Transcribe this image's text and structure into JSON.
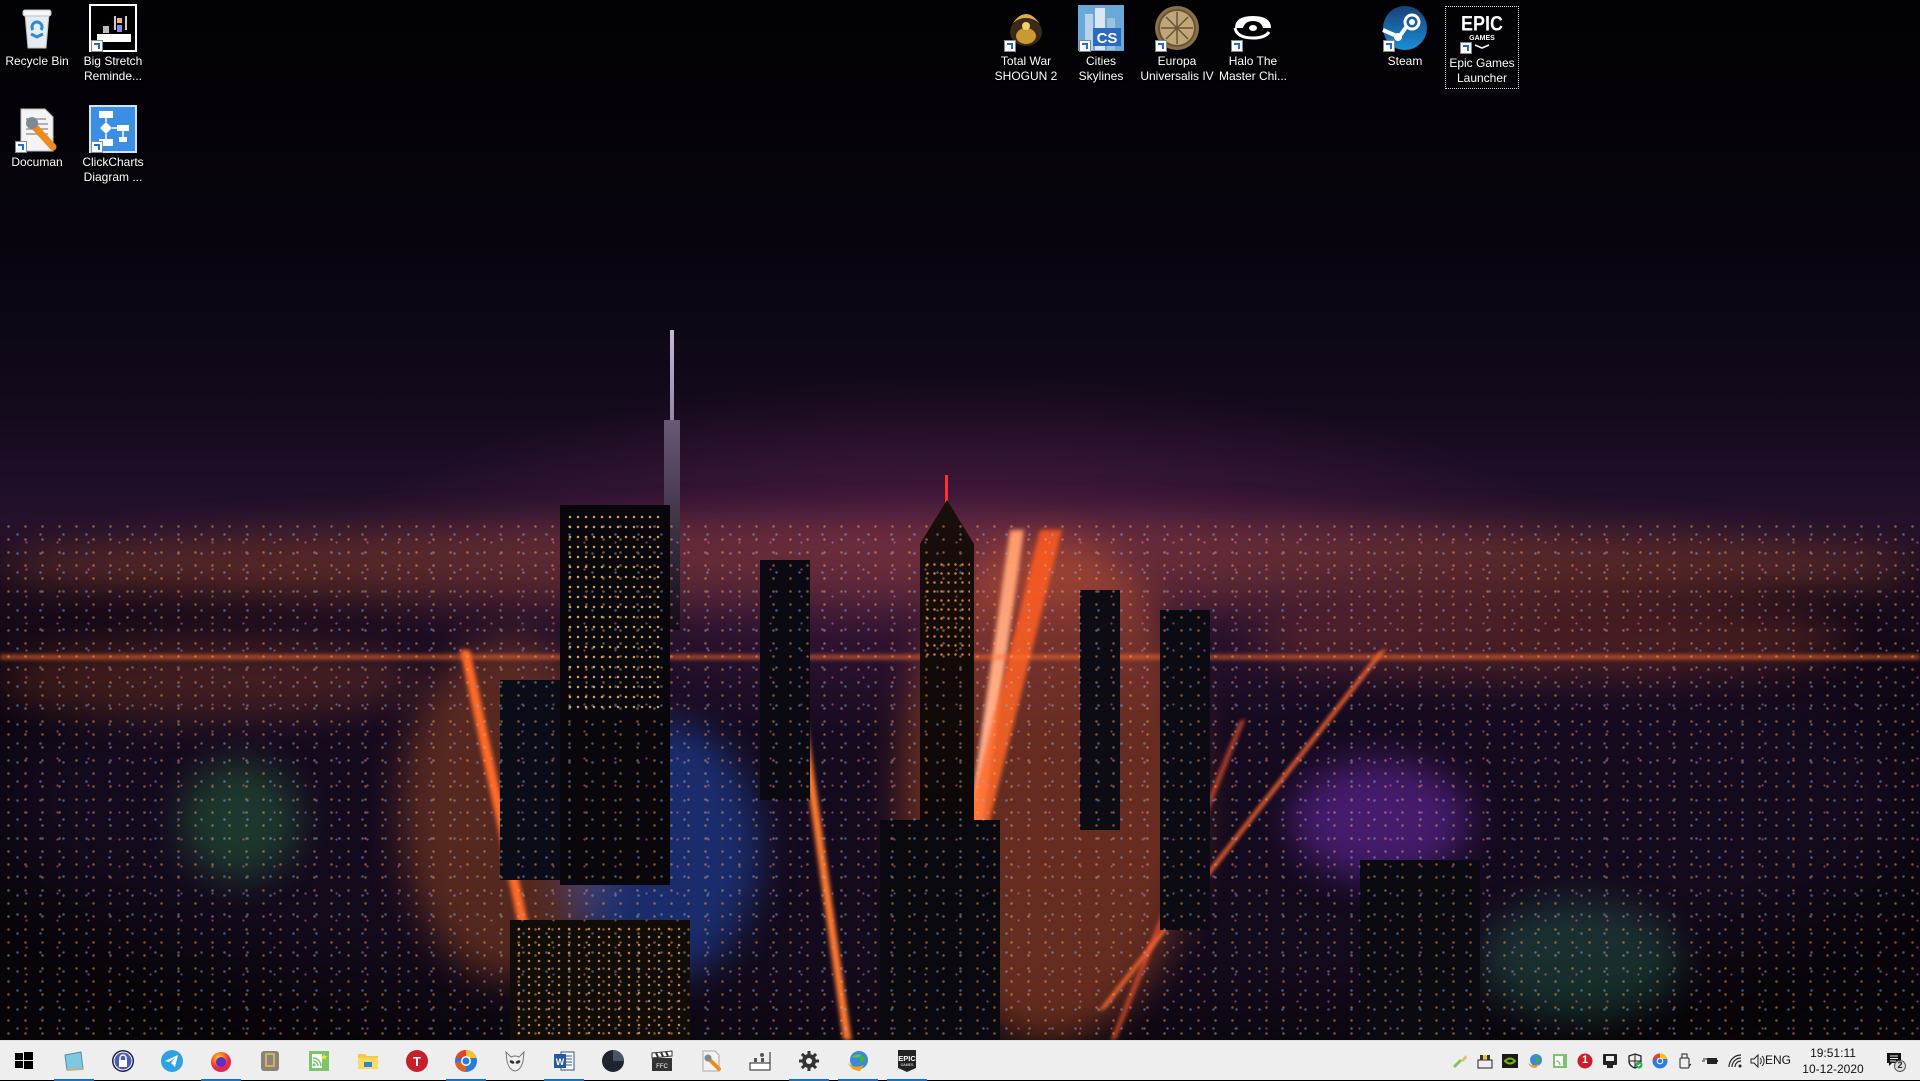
{
  "desktop": {
    "wallpaper": "night-city-skyline",
    "icons": [
      {
        "label": "Recycle Bin",
        "icon": "recycle-bin-icon",
        "shortcut": false
      },
      {
        "label": "Big Stretch Reminde...",
        "icon": "big-stretch-reminder-icon",
        "shortcut": true
      },
      {
        "label": "Documan",
        "icon": "documan-icon",
        "shortcut": true
      },
      {
        "label": "ClickCharts Diagram ...",
        "icon": "clickcharts-icon",
        "shortcut": true
      },
      {
        "label": "Total War SHOGUN 2",
        "icon": "total-war-shogun2-icon",
        "shortcut": true
      },
      {
        "label": "Cities Skylines",
        "icon": "cities-skylines-icon",
        "shortcut": true
      },
      {
        "label": "Europa Universalis IV",
        "icon": "europa-universalis-icon",
        "shortcut": true
      },
      {
        "label": "Halo The Master Chi...",
        "icon": "halo-icon",
        "shortcut": true
      },
      {
        "label": "Steam",
        "icon": "steam-icon",
        "shortcut": true
      },
      {
        "label": "Epic Games Launcher",
        "icon": "epic-games-icon",
        "shortcut": true,
        "selected": true
      }
    ]
  },
  "taskbar": {
    "start": {
      "icon": "windows-start-icon"
    },
    "pinned": [
      {
        "name": "notepad",
        "icon": "notepad-icon",
        "active": true
      },
      {
        "name": "keepassxc",
        "icon": "password-manager-lock-icon",
        "active": false
      },
      {
        "name": "telegram",
        "icon": "telegram-icon",
        "active": false
      },
      {
        "name": "firefox",
        "icon": "firefox-icon",
        "active": true
      },
      {
        "name": "clipboard-app",
        "icon": "clipboard-icon",
        "active": false
      },
      {
        "name": "feed-reader",
        "icon": "rss-reader-icon",
        "active": false
      },
      {
        "name": "file-explorer",
        "icon": "file-explorer-icon",
        "active": false
      },
      {
        "name": "t-app",
        "icon": "red-t-icon",
        "active": false
      },
      {
        "name": "chrome",
        "icon": "chrome-canary-icon",
        "active": true
      },
      {
        "name": "alien-app",
        "icon": "alien-head-icon",
        "active": false
      },
      {
        "name": "word",
        "icon": "microsoft-word-icon",
        "active": true
      },
      {
        "name": "dark-app",
        "icon": "dark-circle-app-icon",
        "active": false
      },
      {
        "name": "video-editor",
        "icon": "clapperboard-icon",
        "active": false
      },
      {
        "name": "documan",
        "icon": "documan-icon",
        "active": false
      },
      {
        "name": "big-stretch",
        "icon": "big-stretch-icon",
        "active": false
      },
      {
        "name": "settings",
        "icon": "gear-icon",
        "active": true
      },
      {
        "name": "internet-download-manager",
        "icon": "idm-globe-icon",
        "active": true
      },
      {
        "name": "epic-games",
        "icon": "epic-games-icon",
        "active": true
      }
    ],
    "tray": [
      {
        "name": "tray-brush",
        "icon": "paint-brush-icon"
      },
      {
        "name": "tray-network-monitor",
        "icon": "network-monitor-icon"
      },
      {
        "name": "tray-nvidia",
        "icon": "nvidia-icon"
      },
      {
        "name": "tray-idm",
        "icon": "idm-globe-icon"
      },
      {
        "name": "tray-feed",
        "icon": "rss-reader-icon"
      },
      {
        "name": "tray-notification-badge",
        "icon": "red-badge-icon",
        "badge": "1"
      },
      {
        "name": "tray-monitor",
        "icon": "monitor-app-icon"
      },
      {
        "name": "tray-defender",
        "icon": "shield-check-icon"
      },
      {
        "name": "tray-chrome",
        "icon": "chrome-canary-icon"
      },
      {
        "name": "tray-usb",
        "icon": "usb-drive-icon"
      },
      {
        "name": "tray-power",
        "icon": "battery-plug-icon"
      },
      {
        "name": "tray-wifi",
        "icon": "wifi-icon"
      },
      {
        "name": "tray-volume",
        "icon": "speaker-icon"
      }
    ],
    "language": "ENG",
    "time": "19:51:11",
    "date": "10-12-2020",
    "action_center": {
      "icon": "action-center-icon",
      "count": "2"
    }
  }
}
